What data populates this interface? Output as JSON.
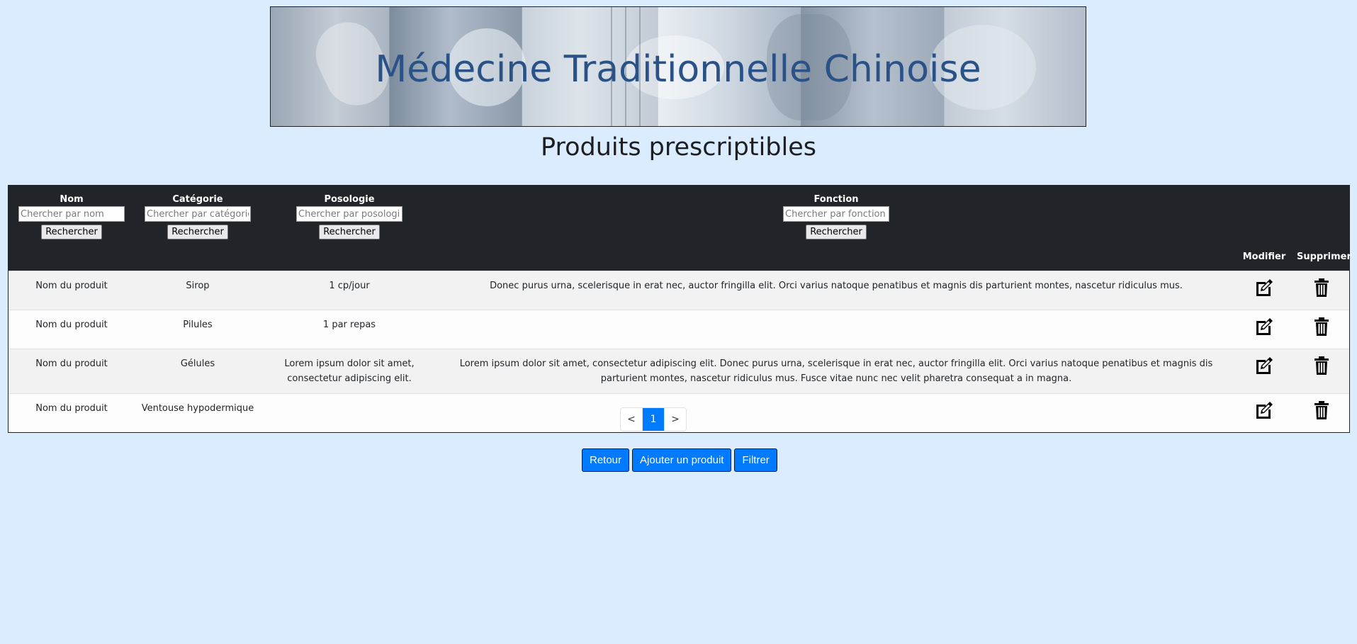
{
  "banner": {
    "title": "Médecine Traditionnelle Chinoise"
  },
  "page_title": "Produits prescriptibles",
  "table": {
    "headers": {
      "nom": {
        "label": "Nom",
        "placeholder": "Chercher par nom",
        "button": "Rechercher"
      },
      "categorie": {
        "label": "Catégorie",
        "placeholder": "Chercher par catégorie",
        "button": "Rechercher"
      },
      "posologie": {
        "label": "Posologie",
        "placeholder": "Chercher par posologie",
        "button": "Rechercher"
      },
      "fonction": {
        "label": "Fonction",
        "placeholder": "Chercher par fonction",
        "button": "Rechercher"
      },
      "modifier": "Modifier",
      "supprimer": "Supprimer"
    },
    "rows": [
      {
        "nom": "Nom du produit",
        "categorie": "Sirop",
        "posologie": "1 cp/jour",
        "fonction": "Donec purus urna, scelerisque in erat nec, auctor fringilla elit. Orci varius natoque penatibus et magnis dis parturient montes, nascetur ridiculus mus."
      },
      {
        "nom": "Nom du produit",
        "categorie": "Pilules",
        "posologie": "1 par repas",
        "fonction": ""
      },
      {
        "nom": "Nom du produit",
        "categorie": "Gélules",
        "posologie": "Lorem ipsum dolor sit amet, consectetur adipiscing elit.",
        "fonction": "Lorem ipsum dolor sit amet, consectetur adipiscing elit. Donec purus urna, scelerisque in erat nec, auctor fringilla elit. Orci varius natoque penatibus et magnis dis parturient montes, nascetur ridiculus mus. Fusce vitae nunc nec velit pharetra consequat a in magna."
      },
      {
        "nom": "Nom du produit",
        "categorie": "Ventouse hypodermique",
        "posologie": "",
        "fonction": ""
      }
    ],
    "icons": {
      "edit": "edit-icon",
      "delete": "trash-icon"
    }
  },
  "pagination": {
    "prev": "<",
    "current": "1",
    "next": ">"
  },
  "actions": {
    "retour": "Retour",
    "ajouter": "Ajouter un produit",
    "filtrer": "Filtrer"
  },
  "colors": {
    "background": "#dbecfe",
    "header_bg": "#212529",
    "accent": "#007bff",
    "banner_title": "#2a5287"
  }
}
